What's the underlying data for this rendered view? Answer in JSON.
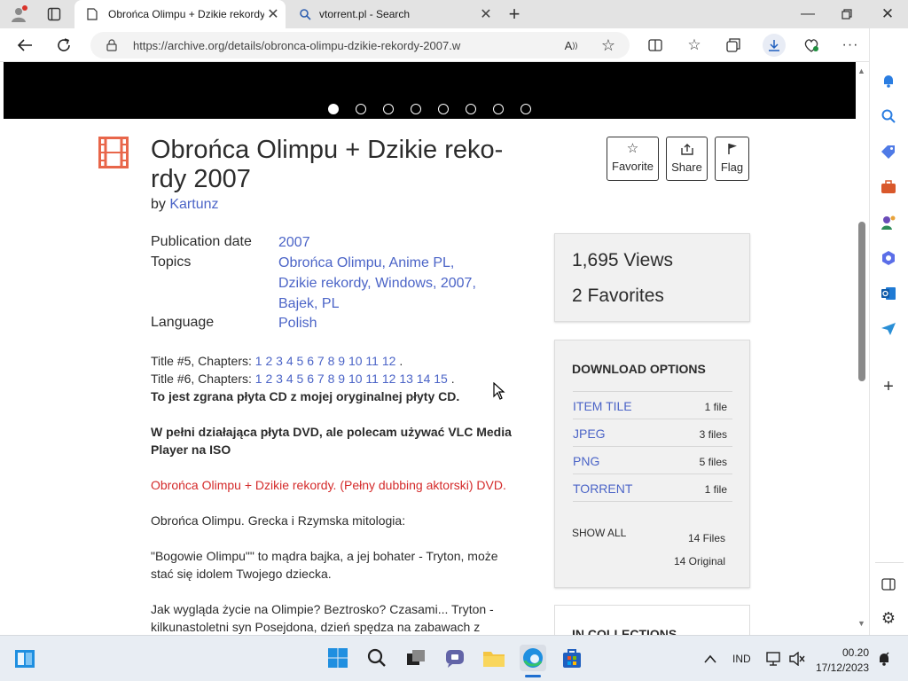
{
  "browser": {
    "tabs": [
      {
        "title": "Obrońca Olimpu + Dzikie rekordy 2007",
        "active": true
      },
      {
        "title": "vtorrent.pl - Search",
        "active": false
      }
    ],
    "url": "https://archive.org/details/obronca-olimpu-dzikie-rekordy-2007.w"
  },
  "item": {
    "title_line1": "Obrońca Olimpu + Dzikie reko-",
    "title_line2": "rdy 2007",
    "by_label": "by",
    "author": "Kartunz",
    "actions": {
      "favorite": "Favorite",
      "share": "Share",
      "flag": "Flag"
    },
    "meta": {
      "publication_date_label": "Publication date",
      "publication_date": "2007",
      "topics_label": "Topics",
      "topics_line1": [
        "Obrońca Olimpu",
        "Anime PL"
      ],
      "topics_line2": [
        "Dzikie rekordy",
        "Windows",
        "2007"
      ],
      "topics_line3": [
        "Bajek",
        "PL"
      ],
      "language_label": "Language",
      "language": "Polish"
    },
    "description": {
      "t5_label": "Title #5, Chapters:",
      "t5_chapters": [
        "1",
        "2",
        "3",
        "4",
        "5",
        "6",
        "7",
        "8",
        "9",
        "10",
        "11",
        "12"
      ],
      "t6_label": "Title #6, Chapters:",
      "t6_chapters": [
        "1",
        "2",
        "3",
        "4",
        "5",
        "6",
        "7",
        "8",
        "9",
        "10",
        "11",
        "12",
        "13",
        "14",
        "15"
      ],
      "bold1": "To jest zgrana płyta CD z mojej oryginalnej płyty CD.",
      "bold2a": "W pełni działająca płyta DVD, ale polecam używać VLC Media",
      "bold2b": "Player na ISO",
      "red": "Obrońca Olimpu + Dzikie rekordy. (Pełny dubbing aktorski) DVD.",
      "p1": "Obrońca Olimpu. Grecka i Rzymska mitologia:",
      "p2a": "\"Bogowie Olimpu\"\" to mądra bajka, a jej bohater - Tryton, może",
      "p2b": "stać się idolem Twojego dziecka.",
      "p3a": "Jak wygląda życie na Olimpie? Beztrosko? Czasami... Tryton -",
      "p3b": "kilkunastoletni syn Posejdona, dzień spędza na zabawach z"
    }
  },
  "stats": {
    "views": "1,695 Views",
    "favorites": "2 Favorites"
  },
  "downloads": {
    "heading": "DOWNLOAD OPTIONS",
    "rows": [
      {
        "name": "ITEM TILE",
        "count": "1 file"
      },
      {
        "name": "JPEG",
        "count": "3 files"
      },
      {
        "name": "PNG",
        "count": "5 files"
      },
      {
        "name": "TORRENT",
        "count": "1 file"
      }
    ],
    "show_all": "SHOW ALL",
    "files": "14 Files",
    "original": "14 Original"
  },
  "collections_heading": "IN COLLECTIONS",
  "taskbar": {
    "language": "IND",
    "time": "00.20",
    "date": "17/12/2023"
  },
  "colors": {
    "accent": "#4b64c7",
    "red": "#d42a2a",
    "film_icon": "#e8664a"
  }
}
